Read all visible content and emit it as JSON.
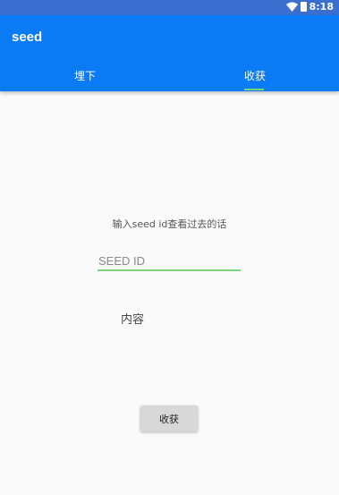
{
  "status_bar": {
    "time": "8:18",
    "wifi_icon": "wifi-icon",
    "battery_icon": "battery-icon"
  },
  "app_bar": {
    "title": "seed"
  },
  "tabs": [
    {
      "label": "埋下",
      "selected": false
    },
    {
      "label": "收获",
      "selected": true
    }
  ],
  "main": {
    "hint": "输入seed id查看过去的话",
    "seed_input": {
      "value": "",
      "placeholder": "SEED ID"
    },
    "content": "内容",
    "harvest_button": "收获"
  },
  "colors": {
    "app_bar": "#0a7bf5",
    "status_bar": "#3a6fd0",
    "accent": "#7bd37b",
    "background": "#fafafa"
  }
}
